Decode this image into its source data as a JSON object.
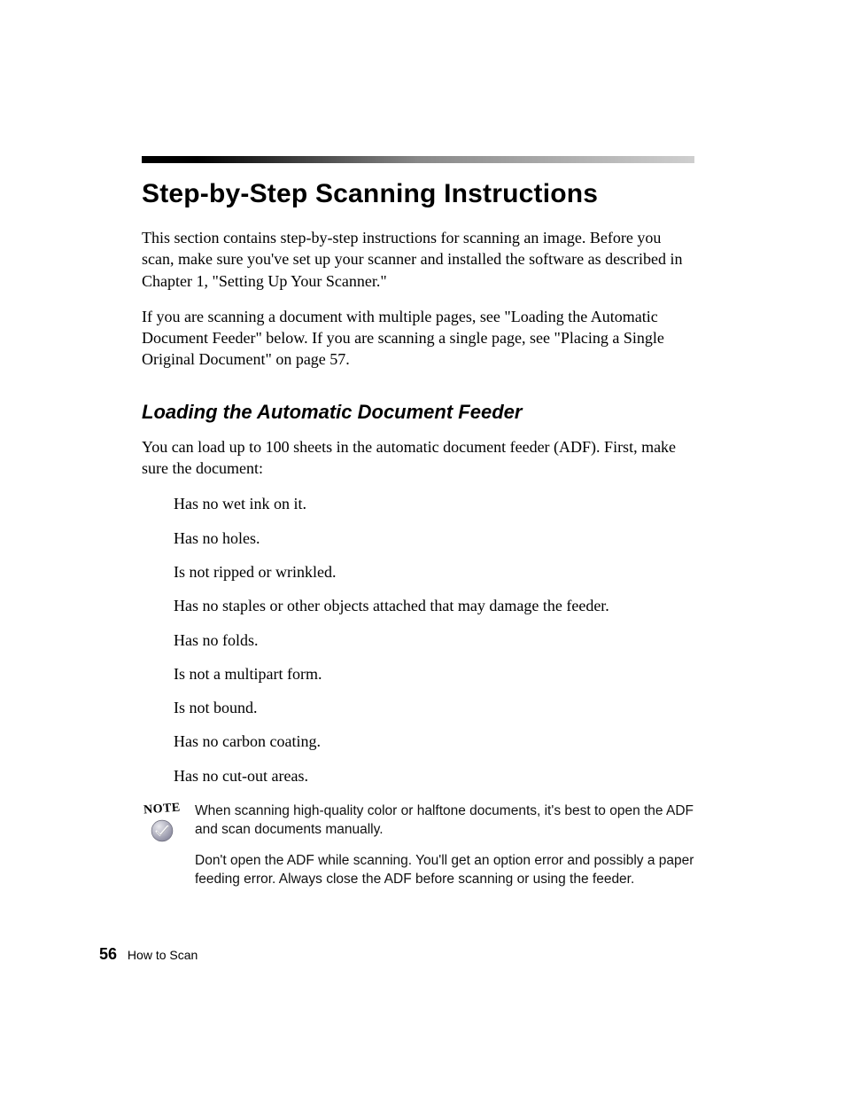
{
  "rule": true,
  "title": "Step-by-Step Scanning Instructions",
  "intro1": "This section contains step-by-step instructions for scanning an image. Before you scan, make sure you've set up your scanner and installed the software as described in Chapter 1, \"Setting Up Your Scanner.\"",
  "intro2": "If you are scanning a document with multiple pages, see \"Loading the Automatic Document Feeder\" below. If you are scanning a single page, see \"Placing a Single Original Document\" on page 57.",
  "subsection": "Loading the Automatic Document Feeder",
  "sub_intro": "You can load up to 100 sheets in the automatic document feeder (ADF). First, make sure the document:",
  "checklist": {
    "i0": "Has no wet ink on it.",
    "i1": "Has no holes.",
    "i2": "Is not ripped or wrinkled.",
    "i3": "Has no staples or other objects attached that may damage the feeder.",
    "i4": "Has no folds.",
    "i5": "Is not a multipart form.",
    "i6": "Is not bound.",
    "i7": "Has no carbon coating.",
    "i8": "Has no cut-out areas."
  },
  "note": {
    "label": "NOTE",
    "p1": "When scanning high-quality color or halftone documents, it's best to open the ADF and scan documents manually.",
    "p2": "Don't open the ADF while scanning. You'll get an option error and possibly a paper feeding error. Always close the ADF before scanning or using the feeder."
  },
  "footer": {
    "page": "56",
    "chapter": "How to Scan"
  }
}
